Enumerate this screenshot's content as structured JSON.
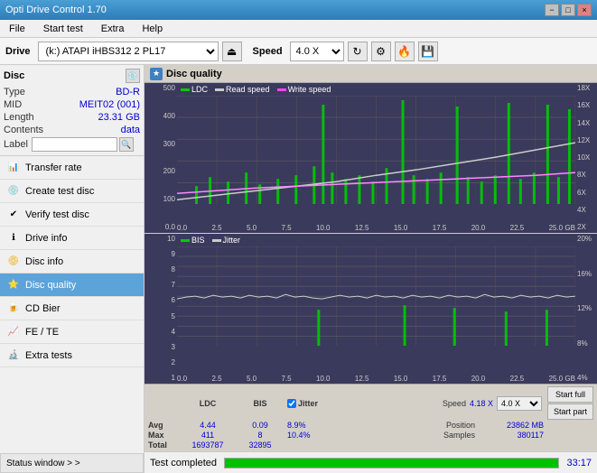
{
  "app": {
    "title": "Opti Drive Control 1.70",
    "minimize_label": "−",
    "maximize_label": "□",
    "close_label": "×"
  },
  "menu": {
    "items": [
      "File",
      "Start test",
      "Extra",
      "Help"
    ]
  },
  "toolbar": {
    "drive_label": "Drive",
    "drive_value": "(k:)  ATAPI iHBS312  2 PL17",
    "speed_label": "Speed",
    "speed_value": "4.0 X"
  },
  "disc": {
    "title": "Disc",
    "type_label": "Type",
    "type_value": "BD-R",
    "mid_label": "MID",
    "mid_value": "MEIT02 (001)",
    "length_label": "Length",
    "length_value": "23.31 GB",
    "contents_label": "Contents",
    "contents_value": "data",
    "label_label": "Label",
    "label_value": ""
  },
  "nav": {
    "items": [
      {
        "id": "transfer-rate",
        "label": "Transfer rate",
        "icon": "📊"
      },
      {
        "id": "create-test-disc",
        "label": "Create test disc",
        "icon": "💿"
      },
      {
        "id": "verify-test-disc",
        "label": "Verify test disc",
        "icon": "✔"
      },
      {
        "id": "drive-info",
        "label": "Drive info",
        "icon": "ℹ"
      },
      {
        "id": "disc-info",
        "label": "Disc info",
        "icon": "📀"
      },
      {
        "id": "disc-quality",
        "label": "Disc quality",
        "icon": "⭐",
        "active": true
      },
      {
        "id": "cd-bier",
        "label": "CD Bier",
        "icon": "🍺"
      },
      {
        "id": "fe-te",
        "label": "FE / TE",
        "icon": "📈"
      },
      {
        "id": "extra-tests",
        "label": "Extra tests",
        "icon": "🔬"
      }
    ]
  },
  "chart": {
    "title": "Disc quality",
    "upper": {
      "legend": [
        {
          "label": "LDC",
          "color": "#00cc00"
        },
        {
          "label": "Read speed",
          "color": "#cccccc"
        },
        {
          "label": "Write speed",
          "color": "#ff44ff"
        }
      ],
      "y_labels": [
        "500",
        "400",
        "300",
        "200",
        "100",
        "0.0"
      ],
      "y_labels_right": [
        "18X",
        "16X",
        "14X",
        "12X",
        "10X",
        "8X",
        "6X",
        "4X",
        "2X"
      ],
      "x_labels": [
        "0.0",
        "2.5",
        "5.0",
        "7.5",
        "10.0",
        "12.5",
        "15.0",
        "17.5",
        "20.0",
        "22.5",
        "25.0 GB"
      ]
    },
    "lower": {
      "legend": [
        {
          "label": "BIS",
          "color": "#00cc00"
        },
        {
          "label": "Jitter",
          "color": "#cccccc"
        }
      ],
      "y_labels": [
        "10",
        "9",
        "8",
        "7",
        "6",
        "5",
        "4",
        "3",
        "2",
        "1"
      ],
      "y_labels_right": [
        "20%",
        "16%",
        "12%",
        "8%",
        "4%"
      ],
      "x_labels": [
        "0.0",
        "2.5",
        "5.0",
        "7.5",
        "10.0",
        "12.5",
        "15.0",
        "17.5",
        "20.0",
        "22.5",
        "25.0 GB"
      ]
    }
  },
  "stats": {
    "ldc_label": "LDC",
    "bis_label": "BIS",
    "jitter_label": "Jitter",
    "jitter_checked": true,
    "speed_label": "Speed",
    "speed_value": "4.18 X",
    "speed_select": "4.0 X",
    "avg_label": "Avg",
    "ldc_avg": "4.44",
    "bis_avg": "0.09",
    "jitter_avg": "8.9%",
    "max_label": "Max",
    "ldc_max": "411",
    "bis_max": "8",
    "jitter_max": "10.4%",
    "total_label": "Total",
    "ldc_total": "1693787",
    "bis_total": "32895",
    "position_label": "Position",
    "position_value": "23862 MB",
    "samples_label": "Samples",
    "samples_value": "380117",
    "start_full_label": "Start full",
    "start_part_label": "Start part"
  },
  "statusbar": {
    "status_text": "Test completed",
    "progress": 100,
    "time": "33:17",
    "status_window_label": "Status window > >"
  }
}
